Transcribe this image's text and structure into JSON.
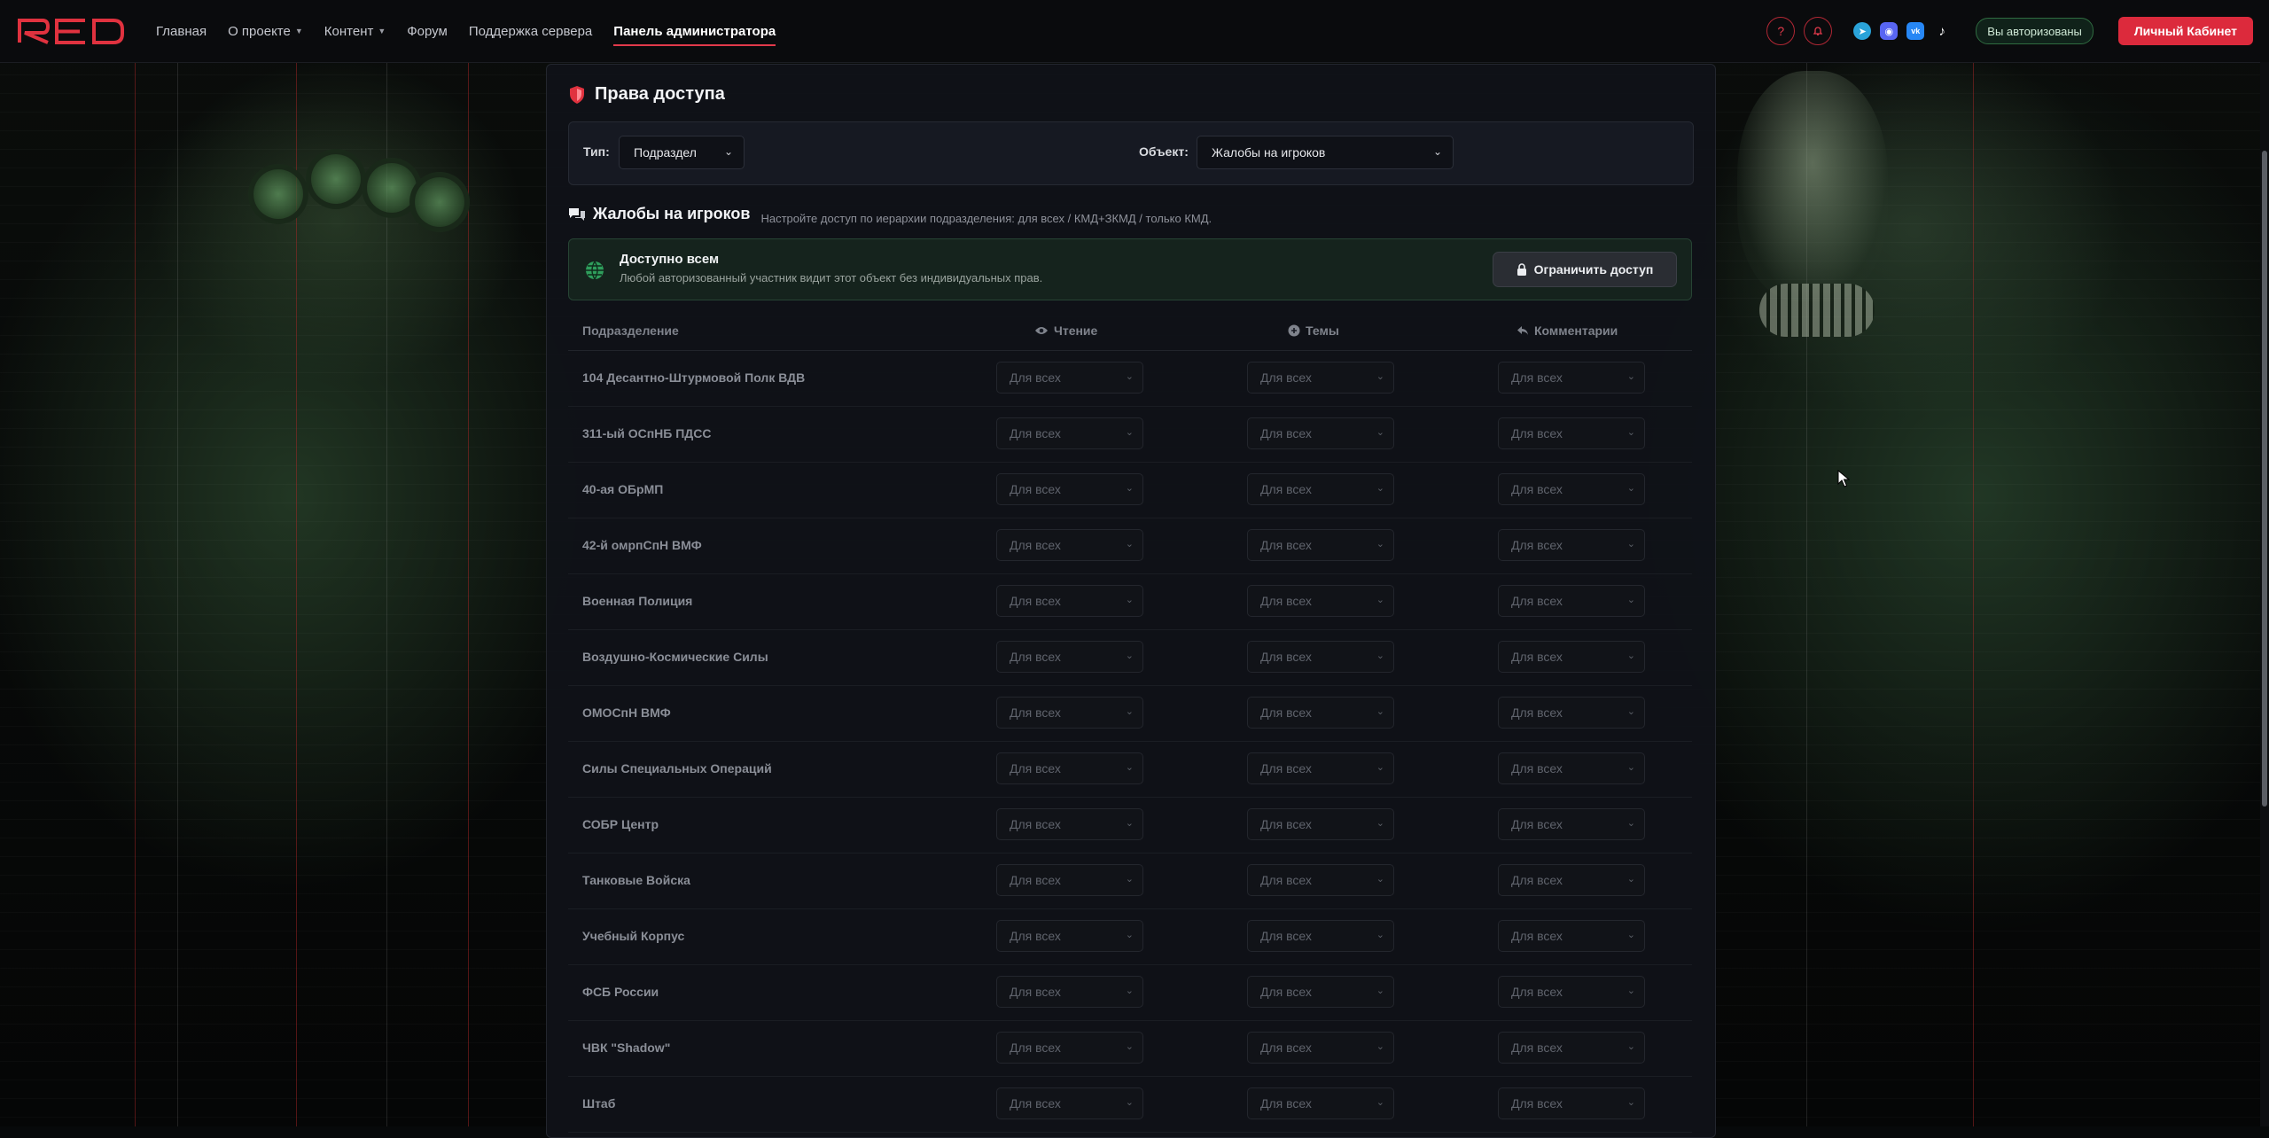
{
  "brand": {
    "logo_text": "RED",
    "accent": "#dc2a3c"
  },
  "nav": {
    "links": [
      {
        "label": "Главная",
        "has_caret": false
      },
      {
        "label": "О проекте",
        "has_caret": true
      },
      {
        "label": "Контент",
        "has_caret": true
      },
      {
        "label": "Форум",
        "has_caret": false
      },
      {
        "label": "Поддержка сервера",
        "has_caret": false
      },
      {
        "label": "Панель администратора",
        "has_caret": false,
        "active": true
      }
    ],
    "icons": [
      "help-icon",
      "bell-icon",
      "telegram-icon",
      "discord-icon",
      "vk-icon",
      "tiktok-icon"
    ],
    "auth_badge": "Вы авторизованы",
    "cabinet_button": "Личный Кабинет"
  },
  "panel": {
    "title": "Права доступа",
    "filters": {
      "type_label": "Тип:",
      "type_value": "Подраздел",
      "object_label": "Объект:",
      "object_value": "Жалобы на игроков"
    },
    "section": {
      "title": "Жалобы на игроков",
      "subtitle": "Настройте доступ по иерархии подразделения: для всех / КМД+ЗКМД / только КМД."
    },
    "availability": {
      "title": "Доступно всем",
      "subtitle": "Любой авторизованный участник видит этот объект без индивидуальных прав.",
      "button": "Ограничить доступ"
    },
    "table": {
      "columns": {
        "division": "Подразделение",
        "read": "Чтение",
        "topics": "Темы",
        "comments": "Комментарии"
      },
      "rows": [
        {
          "name": "104 Десантно-Штурмовой Полк ВДВ",
          "read": "Для всех",
          "topics": "Для всех",
          "comments": "Для всех"
        },
        {
          "name": "311-ый ОСпНБ ПДСС",
          "read": "Для всех",
          "topics": "Для всех",
          "comments": "Для всех"
        },
        {
          "name": "40-ая ОБрМП",
          "read": "Для всех",
          "topics": "Для всех",
          "comments": "Для всех"
        },
        {
          "name": "42-й омрпСпН ВМФ",
          "read": "Для всех",
          "topics": "Для всех",
          "comments": "Для всех"
        },
        {
          "name": "Военная Полиция",
          "read": "Для всех",
          "topics": "Для всех",
          "comments": "Для всех"
        },
        {
          "name": "Воздушно-Космические Силы",
          "read": "Для всех",
          "topics": "Для всех",
          "comments": "Для всех"
        },
        {
          "name": "ОМОСпН ВМФ",
          "read": "Для всех",
          "topics": "Для всех",
          "comments": "Для всех"
        },
        {
          "name": "Силы Специальных Операций",
          "read": "Для всех",
          "topics": "Для всех",
          "comments": "Для всех"
        },
        {
          "name": "СОБР Центр",
          "read": "Для всех",
          "topics": "Для всех",
          "comments": "Для всех"
        },
        {
          "name": "Танковые Войска",
          "read": "Для всех",
          "topics": "Для всех",
          "comments": "Для всех"
        },
        {
          "name": "Учебный Корпус",
          "read": "Для всех",
          "topics": "Для всех",
          "comments": "Для всех"
        },
        {
          "name": "ФСБ России",
          "read": "Для всех",
          "topics": "Для всех",
          "comments": "Для всех"
        },
        {
          "name": "ЧВК \"Shadow\"",
          "read": "Для всех",
          "topics": "Для всех",
          "comments": "Для всех"
        },
        {
          "name": "Штаб",
          "read": "Для всех",
          "topics": "Для всех",
          "comments": "Для всех"
        }
      ]
    }
  }
}
